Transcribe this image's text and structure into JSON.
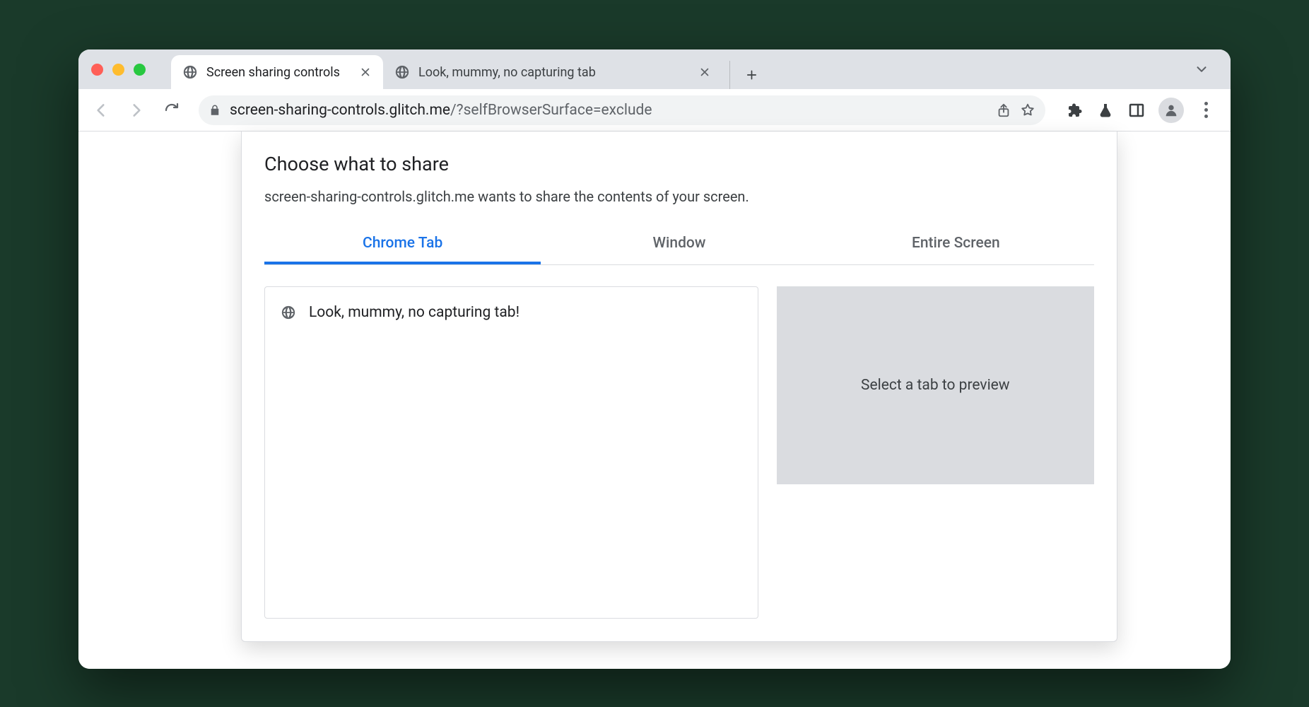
{
  "browser": {
    "tabs": [
      {
        "title": "Screen sharing controls",
        "active": true
      },
      {
        "title": "Look, mummy, no capturing tab",
        "active": false
      }
    ],
    "url_host": "screen-sharing-controls.glitch.me",
    "url_path": "/?selfBrowserSurface=exclude"
  },
  "dialog": {
    "title": "Choose what to share",
    "subtitle": "screen-sharing-controls.glitch.me wants to share the contents of your screen.",
    "tabs": [
      {
        "label": "Chrome Tab",
        "active": true
      },
      {
        "label": "Window",
        "active": false
      },
      {
        "label": "Entire Screen",
        "active": false
      }
    ],
    "tab_items": [
      {
        "title": "Look, mummy, no capturing tab!"
      }
    ],
    "preview_placeholder": "Select a tab to preview"
  }
}
